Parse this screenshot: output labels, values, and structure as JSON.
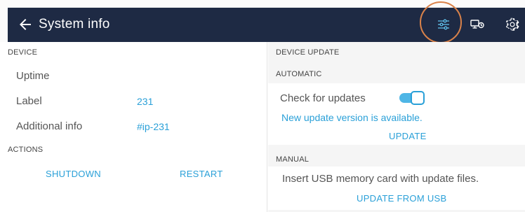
{
  "header": {
    "title": "System info",
    "icons": [
      "back-arrow-icon",
      "settings-sliders-icon",
      "monitor-timer-icon",
      "gear-icon"
    ],
    "bar_color": "#1e2a44",
    "highlight_color": "#d9824a"
  },
  "device": {
    "section_title": "DEVICE",
    "rows": [
      {
        "label": "Uptime",
        "value": ""
      },
      {
        "label": "Label",
        "value": "231"
      },
      {
        "label": "Additional info",
        "value": "#ip-231"
      }
    ]
  },
  "actions": {
    "section_title": "ACTIONS",
    "shutdown_label": "SHUTDOWN",
    "restart_label": "RESTART"
  },
  "device_update": {
    "section_title": "DEVICE UPDATE",
    "automatic": {
      "title": "AUTOMATIC",
      "check_label": "Check for updates",
      "toggle_on": true,
      "notice": "New update version is available.",
      "update_label": "UPDATE"
    },
    "manual": {
      "title": "MANUAL",
      "instructions": "Insert USB memory card with update files.",
      "update_usb_label": "UPDATE FROM USB"
    }
  },
  "accent_color": "#2aa0d8"
}
